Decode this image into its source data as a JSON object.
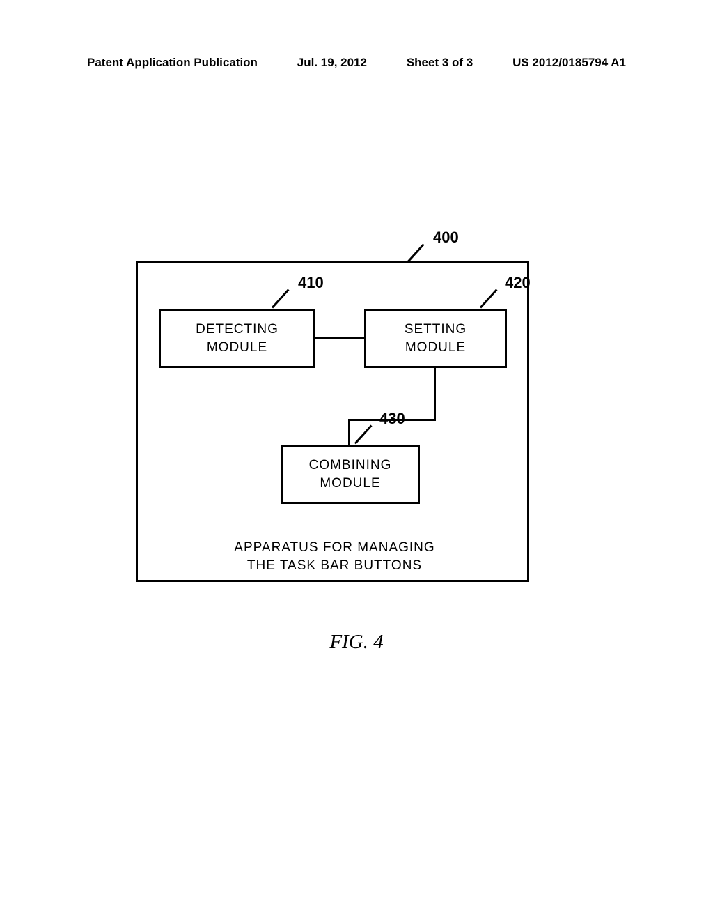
{
  "header": {
    "left": "Patent Application Publication",
    "date": "Jul. 19, 2012",
    "sheet": "Sheet 3 of 3",
    "pubno": "US 2012/0185794 A1"
  },
  "refs": {
    "outer": "400",
    "detecting": "410",
    "setting": "420",
    "combining": "430"
  },
  "modules": {
    "detecting_l1": "DETECTING",
    "detecting_l2": "MODULE",
    "setting_l1": "SETTING",
    "setting_l2": "MODULE",
    "combining_l1": "COMBINING",
    "combining_l2": "MODULE"
  },
  "caption_l1": "APPARATUS FOR  MANAGING",
  "caption_l2": "THE TASK BAR BUTTONS",
  "figure_label": "FIG. 4"
}
